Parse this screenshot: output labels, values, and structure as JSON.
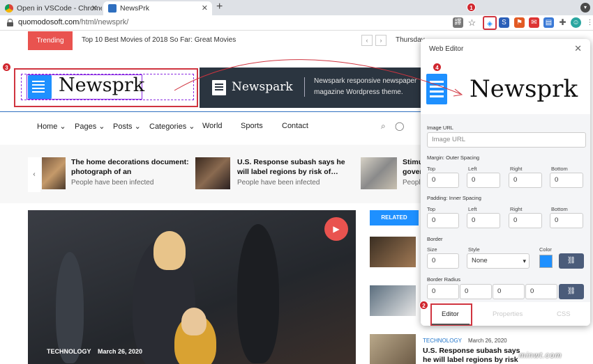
{
  "browser": {
    "tabs": [
      {
        "title": "Open in VSCode - Chrome 線上…",
        "active": false
      },
      {
        "title": "NewsPrk",
        "active": true
      }
    ],
    "url_host": "quomodosoft.com",
    "url_path": "/html/newsprk/"
  },
  "site": {
    "trending_label": "Trending",
    "trending_headline": "Top 10 Best Movies of 2018 So Far: Great Movies",
    "date_text": "Thursday",
    "logo_text": "Newsprk",
    "banner_logo": "Newspark",
    "banner_text": "Newspark responsive newspaper magazine Wordpress theme.",
    "nav": [
      "Home",
      "Pages",
      "Posts",
      "Categories",
      "World",
      "Sports",
      "Contact"
    ],
    "news": [
      {
        "title": "The home decorations document: photograph of an",
        "sub": "People have been infected"
      },
      {
        "title": "U.S. Response subash says he will label regions by risk of…",
        "sub": "People have been infected"
      },
      {
        "title": "Stimu… gover…",
        "sub": "People…"
      }
    ],
    "hero_category": "TECHNOLOGY",
    "hero_date": "March 26, 2020",
    "related_label": "RELATED",
    "side_category": "TECHNOLOGY",
    "side_date": "March 26, 2020",
    "side_title": "U.S. Response subash says he will label regions by risk of…"
  },
  "panel": {
    "title": "Web Editor",
    "preview_logo": "Newsprk",
    "image_url_label": "Image URL",
    "image_url_placeholder": "Image URL",
    "margin_label": "Margin: Outer Spacing",
    "padding_label": "Padding: Inner Spacing",
    "sides": [
      "Top",
      "Left",
      "Right",
      "Bottom"
    ],
    "margin_values": [
      "0",
      "0",
      "0",
      "0"
    ],
    "padding_values": [
      "0",
      "0",
      "0",
      "0"
    ],
    "border_label": "Border",
    "size_label": "Size",
    "style_label": "Style",
    "color_label": "Color",
    "border_size": "0",
    "border_style": "None",
    "border_color": "#1e90ff",
    "radius_label": "Border Radius",
    "radius_values": [
      "0",
      "0",
      "0",
      "0"
    ],
    "tabs": [
      "Editor",
      "Properties",
      "CSS"
    ],
    "active_tab": "Editor"
  },
  "markers": [
    "1",
    "2",
    "3",
    "4"
  ],
  "watermark": "minwt.com"
}
